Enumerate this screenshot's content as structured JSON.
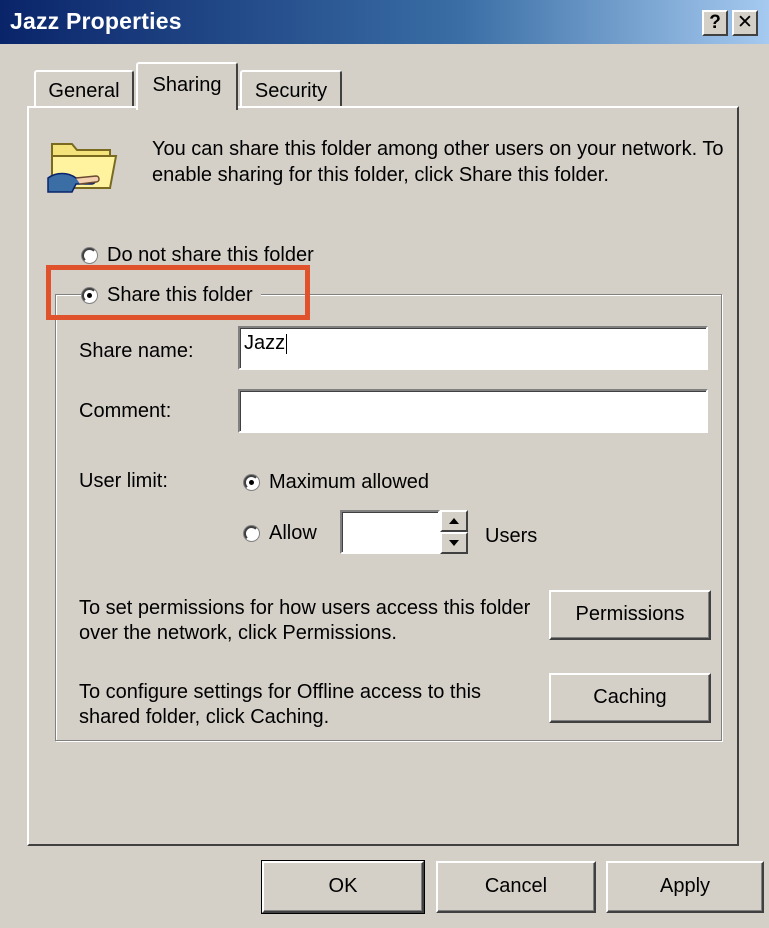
{
  "window": {
    "title": "Jazz Properties",
    "help_label": "?",
    "close_label": "✕"
  },
  "tabs": [
    {
      "label": "General"
    },
    {
      "label": "Sharing"
    },
    {
      "label": "Security"
    }
  ],
  "intro_text": "You can share this folder among other users on your network.  To enable sharing for this folder, click Share this folder.",
  "sharing": {
    "do_not_share_label": "Do not share this folder",
    "share_label": "Share this folder",
    "share_name_label": "Share name:",
    "share_name_value": "Jazz",
    "comment_label": "Comment:",
    "comment_value": "",
    "user_limit_label": "User limit:",
    "max_allowed_label": "Maximum allowed",
    "allow_label": "Allow",
    "allow_value": "",
    "users_label": "Users"
  },
  "permissions": {
    "text": "To set permissions for how users access this folder over the network, click Permissions.",
    "button_label": "Permissions"
  },
  "caching": {
    "text": "To configure settings for Offline access to this shared folder, click Caching.",
    "button_label": "Caching"
  },
  "buttons": {
    "ok_label": "OK",
    "cancel_label": "Cancel",
    "apply_label": "Apply"
  },
  "icons": {
    "folder": "shared-folder-icon",
    "spin_up": "spin-up-icon",
    "spin_down": "spin-down-icon"
  },
  "colors": {
    "title_bar": "#0a246a",
    "dialog_face": "#d4d0c8",
    "highlight_box": "#e0522b"
  }
}
